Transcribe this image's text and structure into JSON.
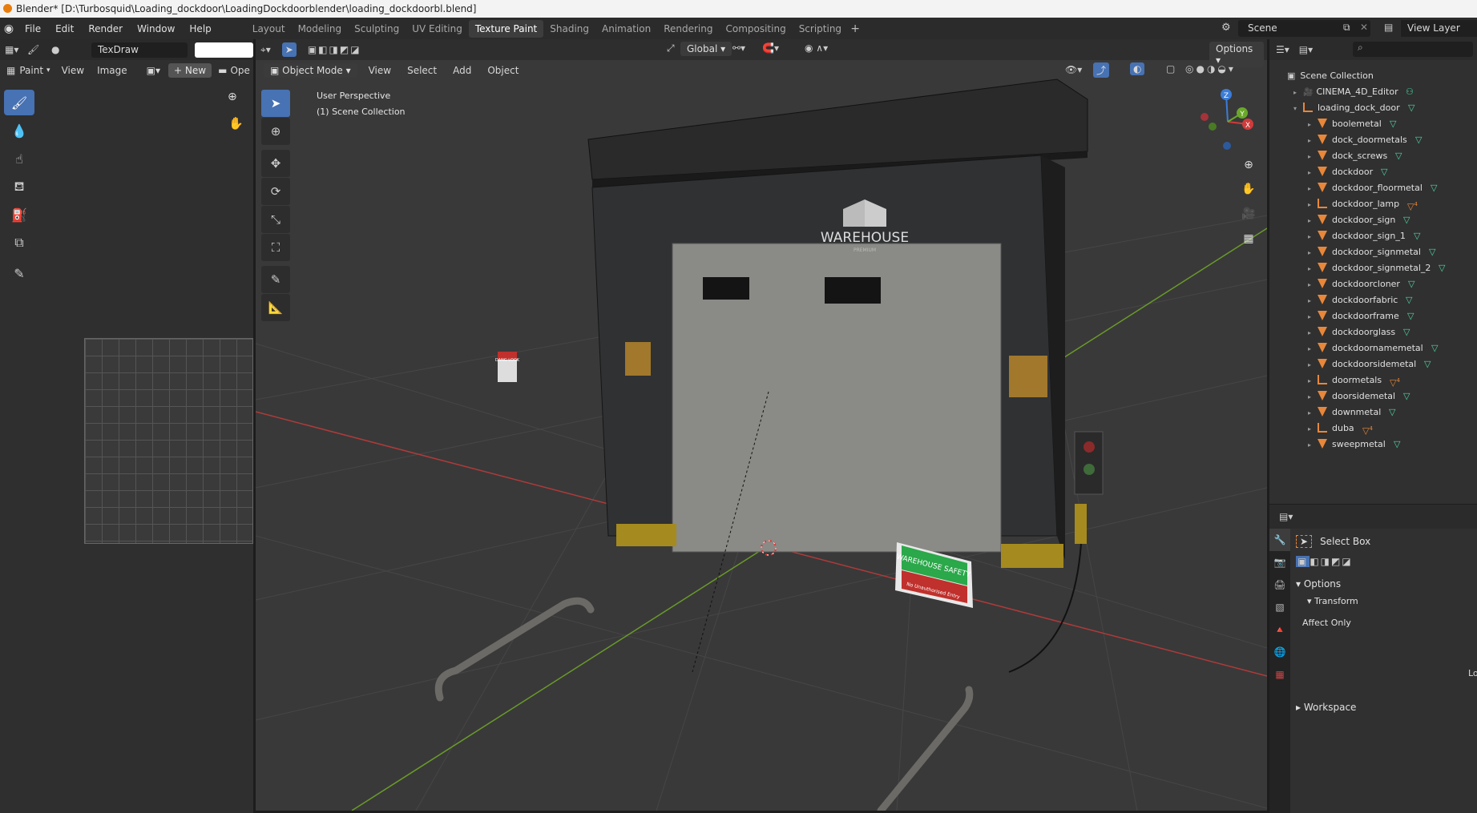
{
  "title_bar": {
    "text": "Blender* [D:\\Turbosquid\\Loading_dockdoor\\LoadingDockdoorblender\\loading_dockdoorbl.blend]"
  },
  "top_menu": [
    "File",
    "Edit",
    "Render",
    "Window",
    "Help"
  ],
  "workspace_tabs": [
    {
      "label": "Layout"
    },
    {
      "label": "Modeling"
    },
    {
      "label": "Sculpting"
    },
    {
      "label": "UV Editing"
    },
    {
      "label": "Texture Paint",
      "active": true
    },
    {
      "label": "Shading"
    },
    {
      "label": "Animation"
    },
    {
      "label": "Rendering"
    },
    {
      "label": "Compositing"
    },
    {
      "label": "Scripting"
    }
  ],
  "add_workspace": "+",
  "scene": {
    "name": "Scene"
  },
  "view_layer": {
    "name": "View Layer"
  },
  "image_editor": {
    "brush_name": "TexDraw",
    "mode": "Paint",
    "menus": [
      "View",
      "Image"
    ],
    "new_button": "New",
    "open_button": "Ope"
  },
  "viewport": {
    "mode": "Object Mode",
    "menus": [
      "View",
      "Select",
      "Add",
      "Object"
    ],
    "orientation": "Global",
    "options": "Options",
    "overlay_line1": "User Perspective",
    "overlay_line2": "(1) Scene Collection",
    "gizmo_axes": {
      "x": "X",
      "y": "Y",
      "z": "Z"
    },
    "scene_text": {
      "sign_brand": "WAREHOUSE",
      "sign_sub": "PREMIUM",
      "safety_sign": "WAREHOUSE SAFETY",
      "safety_sub": "No Unauthorised Entry",
      "danger": "DANG LOOK"
    }
  },
  "outliner": {
    "root": "Scene Collection",
    "items": [
      {
        "label": "CINEMA_4D_Editor",
        "kind": "camera",
        "indent": 1
      },
      {
        "label": "loading_dock_door",
        "kind": "empty",
        "indent": 1,
        "expanded": true
      },
      {
        "label": "boolemetal",
        "kind": "mesh",
        "indent": 2
      },
      {
        "label": "dock_doormetals",
        "kind": "mesh",
        "indent": 2
      },
      {
        "label": "dock_screws",
        "kind": "mesh",
        "indent": 2
      },
      {
        "label": "dockdoor",
        "kind": "mesh",
        "indent": 2
      },
      {
        "label": "dockdoor_floormetal",
        "kind": "mesh",
        "indent": 2
      },
      {
        "label": "dockdoor_lamp",
        "kind": "empty",
        "indent": 2,
        "badge": "4"
      },
      {
        "label": "dockdoor_sign",
        "kind": "mesh",
        "indent": 2
      },
      {
        "label": "dockdoor_sign_1",
        "kind": "mesh",
        "indent": 2
      },
      {
        "label": "dockdoor_signmetal",
        "kind": "mesh",
        "indent": 2
      },
      {
        "label": "dockdoor_signmetal_2",
        "kind": "mesh",
        "indent": 2
      },
      {
        "label": "dockdoorcloner",
        "kind": "mesh",
        "indent": 2
      },
      {
        "label": "dockdoorfabric",
        "kind": "mesh",
        "indent": 2
      },
      {
        "label": "dockdoorframe",
        "kind": "mesh",
        "indent": 2
      },
      {
        "label": "dockdoorglass",
        "kind": "mesh",
        "indent": 2
      },
      {
        "label": "dockdoornamemetal",
        "kind": "mesh",
        "indent": 2
      },
      {
        "label": "dockdoorsidemetal",
        "kind": "mesh",
        "indent": 2
      },
      {
        "label": "doormetals",
        "kind": "empty",
        "indent": 2,
        "badge": "4"
      },
      {
        "label": "doorsidemetal",
        "kind": "mesh",
        "indent": 2
      },
      {
        "label": "downmetal",
        "kind": "mesh",
        "indent": 2
      },
      {
        "label": "duba",
        "kind": "empty",
        "indent": 2,
        "badge": "4"
      },
      {
        "label": "sweepmetal",
        "kind": "mesh",
        "indent": 2
      }
    ]
  },
  "properties": {
    "tool_name": "Select Box",
    "sections": {
      "options": "Options",
      "transform": "Transform",
      "affect_only": "Affect Only",
      "workspace": "Workspace"
    },
    "cut_label": "Lo"
  },
  "colors": {
    "accent": "#4772b3",
    "orange": "#e87d0d",
    "green": "#4fd6a3"
  }
}
